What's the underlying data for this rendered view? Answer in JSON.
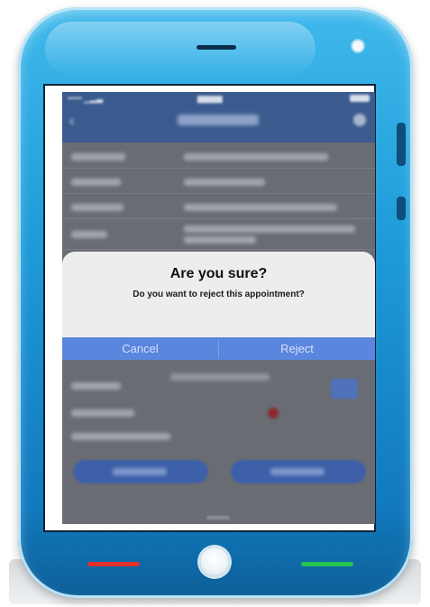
{
  "dialog": {
    "title": "Are you sure?",
    "message": "Do you want to reject this appointment?",
    "cancel_label": "Cancel",
    "reject_label": "Reject"
  },
  "colors": {
    "phone_body": "#1e9bd8",
    "app_header": "#3b5b8e",
    "dialog_background": "#ededee",
    "dialog_actions": "#5a86dd",
    "hang_up": "#e0302c",
    "call": "#27c14d"
  },
  "icons": {
    "back": "chevron-left-icon",
    "home_button": "home-button-icon",
    "speaker": "speaker-icon",
    "camera": "camera-icon",
    "hang_up": "hang-up-icon",
    "call": "call-icon"
  }
}
